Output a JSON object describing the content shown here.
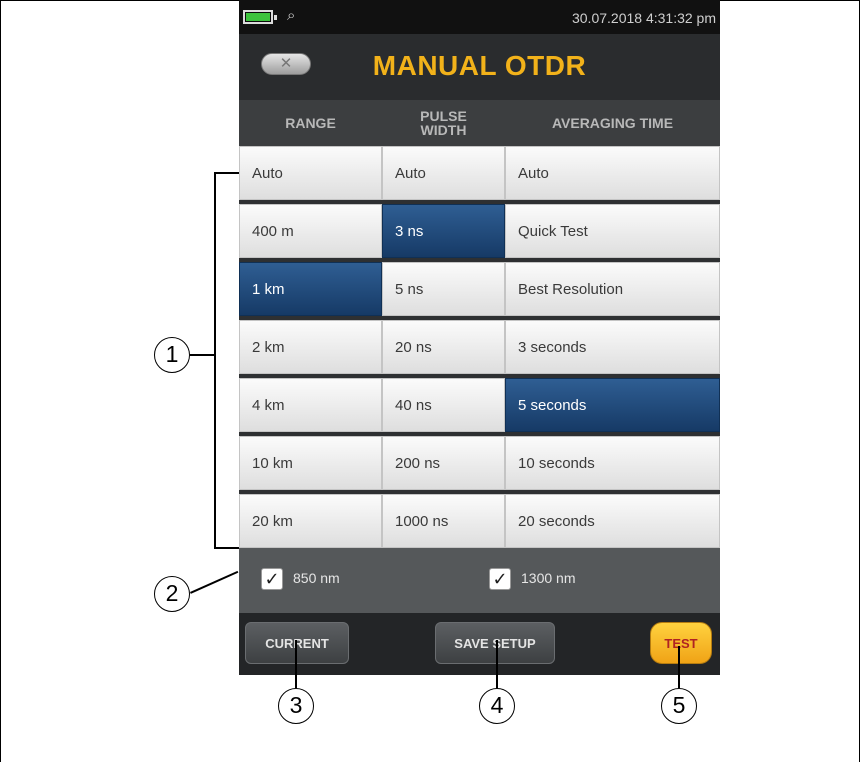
{
  "status_bar": {
    "datetime": "30.07.2018 4:31:32 pm",
    "wifi_icon": "⌕"
  },
  "screen_title": "MANUAL OTDR",
  "back_button": {
    "icon": "✕"
  },
  "columns": {
    "range": {
      "header": "RANGE",
      "options": [
        "Auto",
        "400 m",
        "1 km",
        "2 km",
        "4 km",
        "10 km",
        "20 km"
      ],
      "selected": "1 km"
    },
    "pulse_width": {
      "header_line1": "PULSE",
      "header_line2": "WIDTH",
      "options": [
        "Auto",
        "3 ns",
        "5 ns",
        "20 ns",
        "40 ns",
        "200 ns",
        "1000 ns"
      ],
      "selected": "3 ns"
    },
    "averaging_time": {
      "header": "AVERAGING TIME",
      "options": [
        "Auto",
        "Quick Test",
        "Best Resolution",
        "3 seconds",
        "5 seconds",
        "10 seconds",
        "20 seconds"
      ],
      "selected": "5 seconds"
    }
  },
  "wavelengths": [
    {
      "label": "850 nm",
      "checked": true
    },
    {
      "label": "1300 nm",
      "checked": true
    }
  ],
  "buttons": {
    "current": "CURRENT",
    "save_setup": "SAVE SETUP",
    "test": "TEST"
  },
  "callouts": [
    "1",
    "2",
    "3",
    "4",
    "5"
  ],
  "colors": {
    "accent": "#f2b21a",
    "selected_cell": "#1e4677",
    "test_button": "#f5b321"
  }
}
